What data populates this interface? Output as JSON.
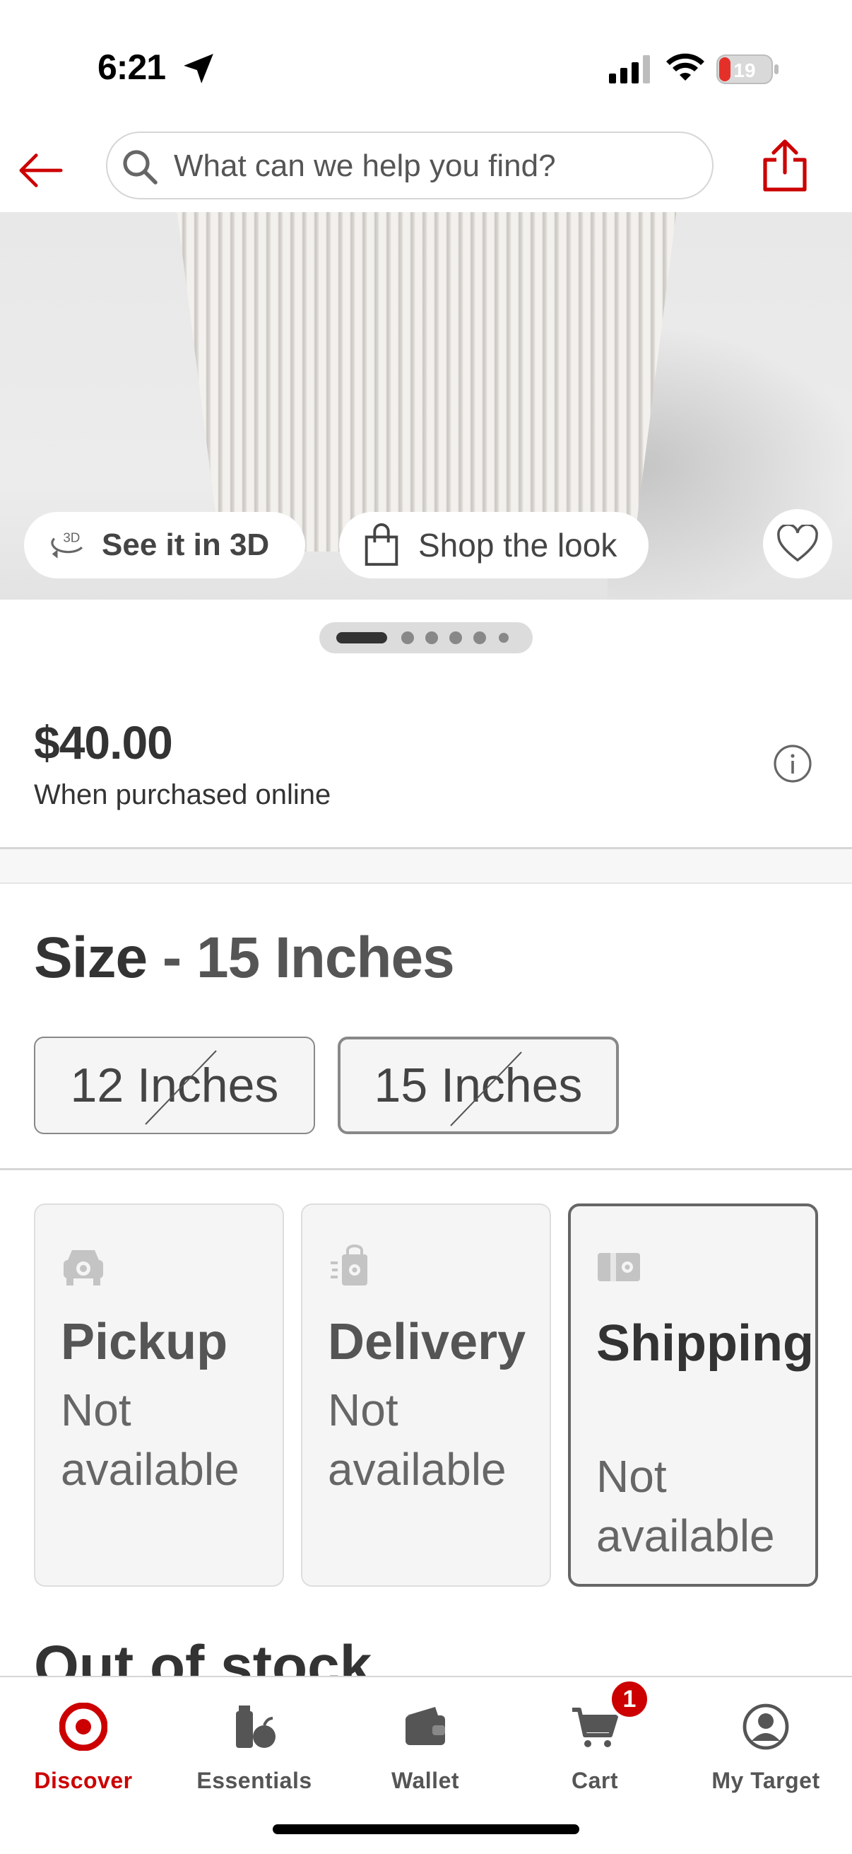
{
  "status_bar": {
    "time": "6:21",
    "battery": "19"
  },
  "search": {
    "placeholder": "What can we help you find?"
  },
  "image_actions": {
    "see_3d": "See it in 3D",
    "shop_look": "Shop the look",
    "icon_3d_text": "3D"
  },
  "carousel": {
    "total": 7,
    "active_index": 0
  },
  "price": {
    "amount": "$40.00",
    "note": "When purchased online"
  },
  "size": {
    "label": "Size",
    "separator": " - ",
    "selected": "15 Inches",
    "options": [
      "12 Inches",
      "15 Inches"
    ]
  },
  "fulfillment": [
    {
      "title": "Pickup",
      "status": "Not available",
      "icon": "car-icon"
    },
    {
      "title": "Delivery",
      "status": "Not available",
      "icon": "delivery-bag-icon"
    },
    {
      "title": "Shipping",
      "status": "Not available",
      "icon": "shipping-box-icon"
    }
  ],
  "stock_heading": "Out of stock",
  "nav": {
    "items": [
      {
        "label": "Discover",
        "icon": "target-logo-icon"
      },
      {
        "label": "Essentials",
        "icon": "essentials-icon"
      },
      {
        "label": "Wallet",
        "icon": "wallet-icon"
      },
      {
        "label": "Cart",
        "icon": "cart-icon"
      },
      {
        "label": "My Target",
        "icon": "account-icon"
      }
    ],
    "cart_count": "1"
  },
  "colors": {
    "brand_red": "#cc0000",
    "text": "#333333"
  }
}
